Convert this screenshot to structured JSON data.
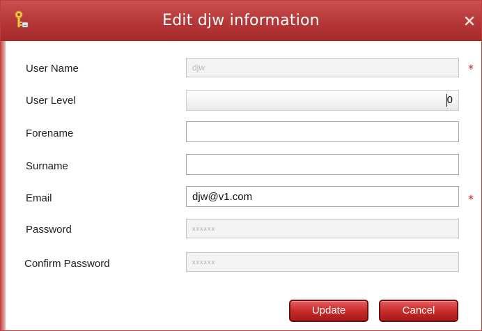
{
  "dialog": {
    "title": "Edit djw information",
    "accent_color": "#b53636",
    "icons": {
      "title_icon": "key-icon",
      "close": "close-icon"
    }
  },
  "form": {
    "user_name": {
      "label": "User Name",
      "value": "djw",
      "required_mark": "*"
    },
    "user_level": {
      "label": "User Level",
      "value": "0"
    },
    "forename": {
      "label": "Forename",
      "value": ""
    },
    "surname": {
      "label": "Surname",
      "value": ""
    },
    "email": {
      "label": "Email",
      "value": "djw@v1.com",
      "required_mark": "*"
    },
    "password": {
      "label": "Password",
      "value": "xxxxxx"
    },
    "confirm_password": {
      "label": "Confirm Password",
      "value": "xxxxxx"
    }
  },
  "buttons": {
    "update": "Update",
    "cancel": "Cancel"
  }
}
